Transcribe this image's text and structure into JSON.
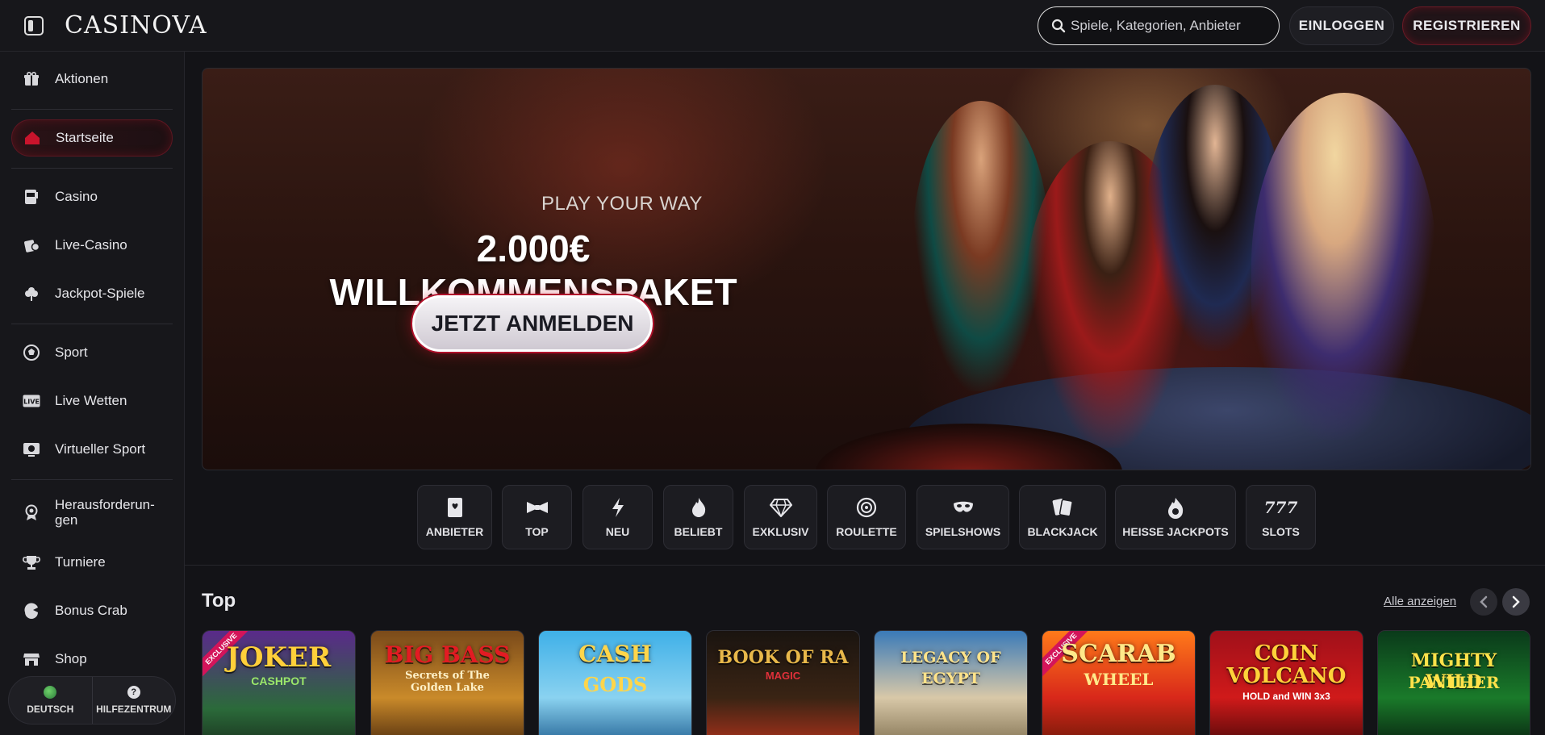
{
  "header": {
    "logo": "CASINOVA",
    "search_placeholder": "Spiele, Kategorien, Anbieter",
    "login_label": "EINLOGGEN",
    "register_label": "REGISTRIEREN"
  },
  "sidebar": {
    "items": [
      {
        "label": "Aktionen",
        "icon": "gift-icon"
      },
      {
        "label": "Startseite",
        "icon": "home-icon",
        "active": true
      },
      {
        "label": "Casino",
        "icon": "slot-machine-icon"
      },
      {
        "label": "Live-Casino",
        "icon": "live-casino-icon"
      },
      {
        "label": "Jackpot-Spiele",
        "icon": "clover-icon"
      },
      {
        "label": "Sport",
        "icon": "soccer-ball-icon"
      },
      {
        "label": "Live Wetten",
        "icon": "live-badge-icon"
      },
      {
        "label": "Virtueller Sport",
        "icon": "virtual-sport-icon"
      },
      {
        "label": "Herausforderun-gen",
        "icon": "medal-icon"
      },
      {
        "label": "Turniere",
        "icon": "trophy-icon"
      },
      {
        "label": "Bonus Crab",
        "icon": "crab-claw-icon"
      },
      {
        "label": "Shop",
        "icon": "shop-icon"
      }
    ],
    "footer": {
      "language_label": "DEUTSCH",
      "help_label": "HILFEZENTRUM"
    }
  },
  "banner": {
    "tagline": "PLAY YOUR WAY",
    "headline": "2.000€ WILLKOMMENSPAKET",
    "cta_label": "JETZT ANMELDEN"
  },
  "categories": [
    {
      "label": "ANBIETER",
      "icon": "provider-book-icon"
    },
    {
      "label": "TOP",
      "icon": "bowtie-icon"
    },
    {
      "label": "NEU",
      "icon": "lightning-icon"
    },
    {
      "label": "BELIEBT",
      "icon": "flame-icon"
    },
    {
      "label": "EXKLUSIV",
      "icon": "diamond-icon"
    },
    {
      "label": "ROULETTE",
      "icon": "roulette-icon"
    },
    {
      "label": "SPIELSHOWS",
      "icon": "mask-icon"
    },
    {
      "label": "BLACKJACK",
      "icon": "cards-icon"
    },
    {
      "label": "HEISSE JACKPOTS",
      "icon": "hot-jackpot-icon"
    },
    {
      "label": "SLOTS",
      "icon": "777-icon"
    }
  ],
  "top_section": {
    "title": "Top",
    "view_all_label": "Alle anzeigen",
    "games": [
      {
        "title": "JOKER",
        "subtitle": "CASHPOT",
        "badge": "EXCLUSIVE"
      },
      {
        "title": "BIG BASS",
        "subtitle": "Secrets of The Golden Lake",
        "badge": ""
      },
      {
        "title": "CASH",
        "subtitle": "GODS",
        "badge": ""
      },
      {
        "title": "BOOK OF RA",
        "subtitle": "MAGIC",
        "badge": ""
      },
      {
        "title": "LEGACY OF EGYPT",
        "subtitle": "",
        "badge": ""
      },
      {
        "title": "SCARAB",
        "subtitle": "WHEEL",
        "badge": "EXCLUSIVE"
      },
      {
        "title": "COIN VOLCANO",
        "subtitle": "HOLD and WIN 3x3",
        "badge": ""
      },
      {
        "title": "MIGHTY WILD",
        "subtitle": "PANTHER",
        "badge": ""
      }
    ]
  },
  "colors": {
    "background": "#131317",
    "accent_red": "#b0102a",
    "badge_pink": "#d4145a"
  }
}
